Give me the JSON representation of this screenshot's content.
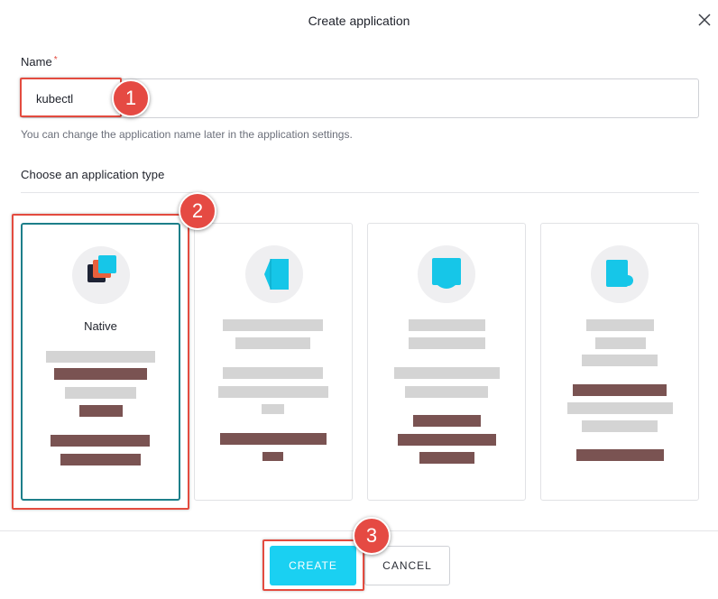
{
  "dialog": {
    "title": "Create application"
  },
  "form": {
    "name_label": "Name",
    "required_mark": "*",
    "name_value": "kubectl",
    "name_hint": "You can change the application name later in the application settings.",
    "type_label": "Choose an application type"
  },
  "app_types": [
    {
      "label": "Native",
      "icon": "native-app-icon",
      "selected": true
    },
    {
      "label": "",
      "icon": "single-page-app-icon",
      "selected": false
    },
    {
      "label": "",
      "icon": "web-app-icon",
      "selected": false
    },
    {
      "label": "",
      "icon": "machine-to-machine-icon",
      "selected": false
    }
  ],
  "buttons": {
    "create": "CREATE",
    "cancel": "CANCEL"
  },
  "annotations": {
    "step1": "1",
    "step2": "2",
    "step3": "3"
  },
  "colors": {
    "accent": "#1ad0f2",
    "selected_border": "#1d7f8a",
    "annotation": "#e34b3f"
  }
}
